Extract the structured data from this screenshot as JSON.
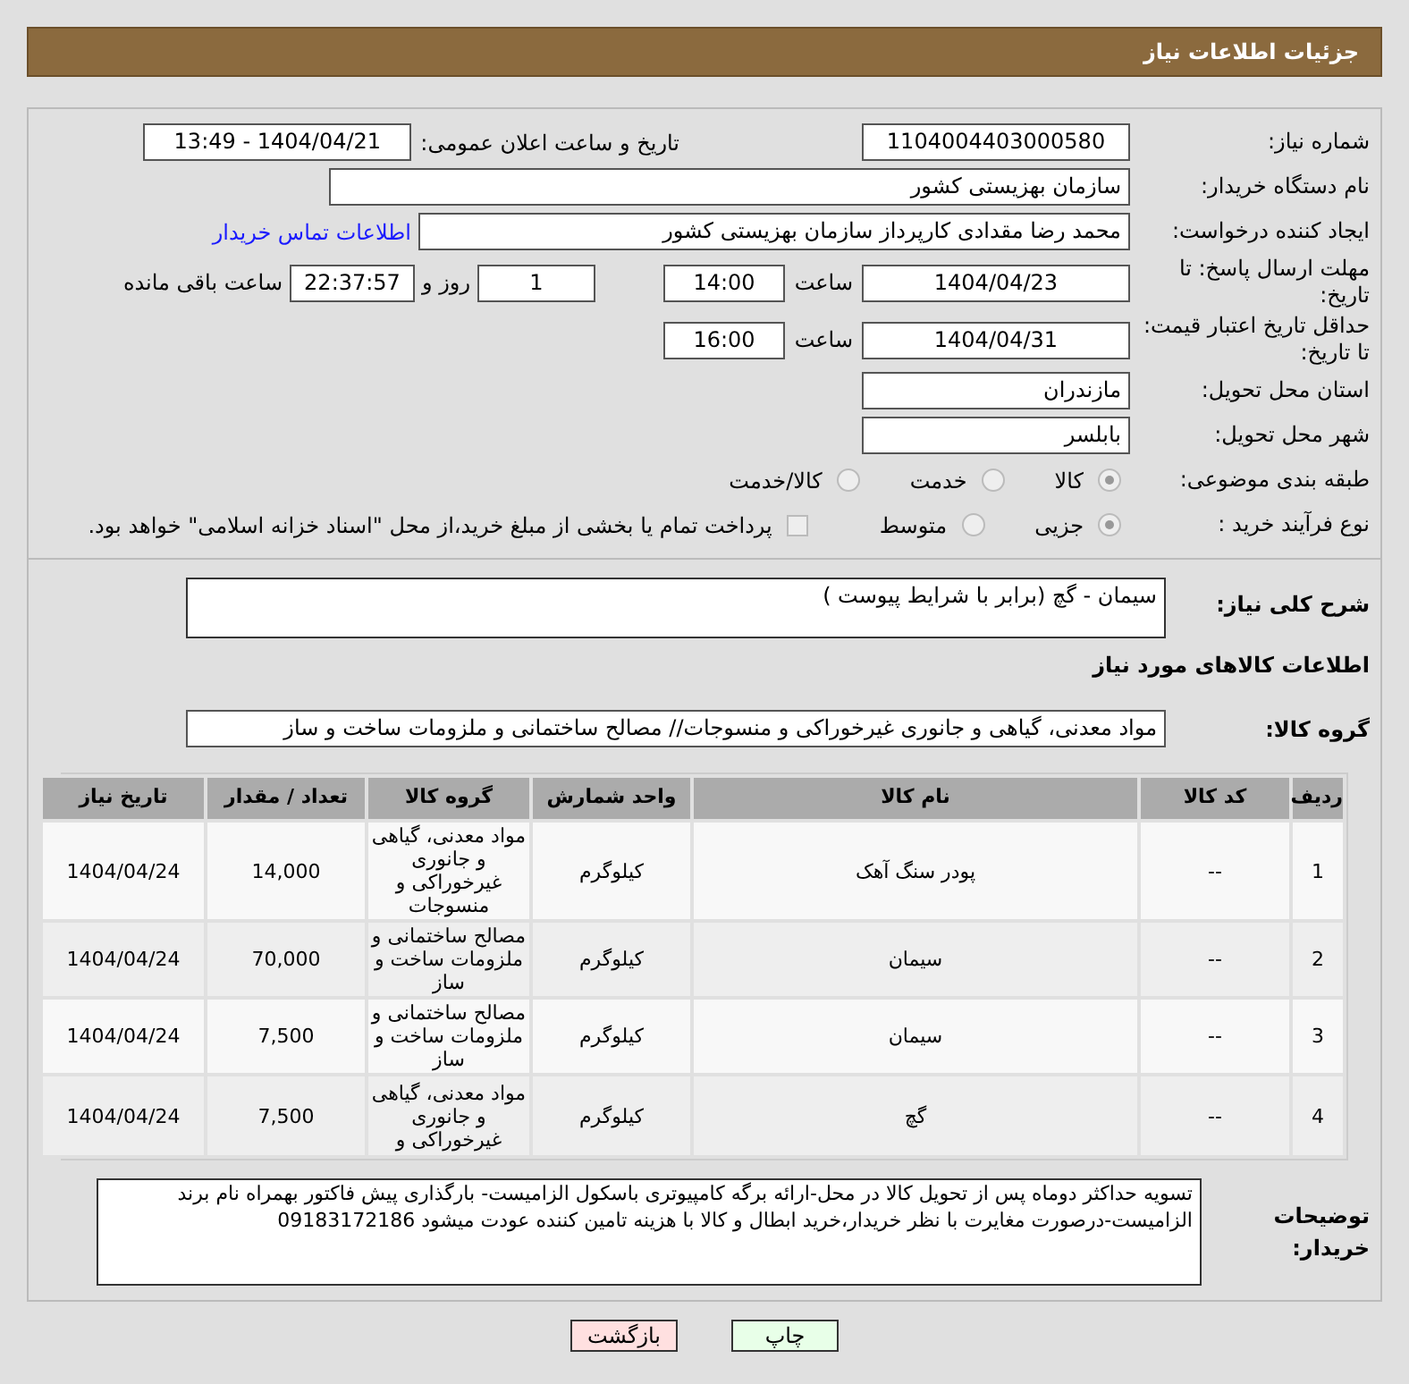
{
  "header": {
    "title": "جزئیات اطلاعات نیاز"
  },
  "need_number": {
    "label": "شماره نیاز:",
    "value": "1104004403000580"
  },
  "announce": {
    "label": "تاریخ و ساعت اعلان عمومی:",
    "value": "1404/04/21 - 13:49"
  },
  "buyer": {
    "label": "نام دستگاه خریدار:",
    "value": "سازمان بهزیستی کشور"
  },
  "requester": {
    "label": "ایجاد کننده درخواست:",
    "value": "محمد رضا  مقدادی کارپرداز سازمان بهزیستی کشور",
    "link": "اطلاعات تماس خریدار"
  },
  "reply_deadline": {
    "label": "مهلت ارسال پاسخ: تا تاریخ:",
    "date": "1404/04/23",
    "time_label": "ساعت",
    "time": "14:00",
    "days": "1",
    "days_label": "روز و",
    "remaining": "22:37:57",
    "remaining_label": "ساعت باقی مانده"
  },
  "price_validity": {
    "label": "حداقل تاریخ اعتبار قیمت: تا تاریخ:",
    "date": "1404/04/31",
    "time_label": "ساعت",
    "time": "16:00"
  },
  "province": {
    "label": "استان محل تحویل:",
    "value": "مازندران"
  },
  "city": {
    "label": "شهر محل تحویل:",
    "value": "بابلسر"
  },
  "category": {
    "label": "طبقه بندی موضوعی:",
    "options": [
      {
        "label": "کالا",
        "selected": true
      },
      {
        "label": "خدمت",
        "selected": false
      },
      {
        "label": "کالا/خدمت",
        "selected": false
      }
    ]
  },
  "process": {
    "label": "نوع فرآیند خرید :",
    "options": [
      {
        "label": "جزیی",
        "selected": true
      },
      {
        "label": "متوسط",
        "selected": false
      }
    ],
    "payment": {
      "label": "پرداخت تمام یا بخشی از مبلغ خرید،از محل \"اسناد خزانه اسلامی\" خواهد بود.",
      "checked": false
    }
  },
  "summary": {
    "label": "شرح کلی نیاز:",
    "value": "سیمان - گچ (برابر با شرایط پیوست )"
  },
  "goods_heading": "اطلاعات کالاهای مورد نیاز",
  "goods_group": {
    "label": "گروه کالا:",
    "value": "مواد معدنی، گیاهی و جانوری غیرخوراکی و منسوجات// مصالح ساختمانی و ملزومات ساخت و ساز"
  },
  "table": {
    "columns": [
      "ردیف",
      "کد کالا",
      "نام کالا",
      "واحد شمارش",
      "گروه کالا",
      "تعداد / مقدار",
      "تاریخ نیاز"
    ],
    "rows": [
      [
        "1",
        "--",
        "پودر سنگ آهک",
        "کیلوگرم",
        "مواد معدنی، گیاهی و جانوری غیرخوراکی و منسوجات",
        "14,000",
        "1404/04/24"
      ],
      [
        "2",
        "--",
        "سیمان",
        "کیلوگرم",
        "مصالح ساختمانی و ملزومات ساخت و ساز",
        "70,000",
        "1404/04/24"
      ],
      [
        "3",
        "--",
        "سیمان",
        "کیلوگرم",
        "مصالح ساختمانی و ملزومات ساخت و ساز",
        "7,500",
        "1404/04/24"
      ],
      [
        "4",
        "--",
        "گچ",
        "کیلوگرم",
        "مواد معدنی، گیاهی و جانوری غیرخوراکی و",
        "7,500",
        "1404/04/24"
      ]
    ]
  },
  "notes": {
    "label": "توضیحات خریدار:",
    "value": "تسویه حداکثر دوماه پس از تحویل کالا در محل-ارائه برگه کامپیوتری باسکول الزامیست- بارگذاری پیش فاکتور بهمراه نام برند الزامیست-درصورت مغایرت با نظر خریدار،خرید ابطال و کالا با هزینه تامین کننده عودت میشود 09183172186"
  },
  "buttons": [
    {
      "label": "چاپ",
      "kind": "print"
    },
    {
      "label": "بازگشت",
      "kind": "back"
    }
  ]
}
